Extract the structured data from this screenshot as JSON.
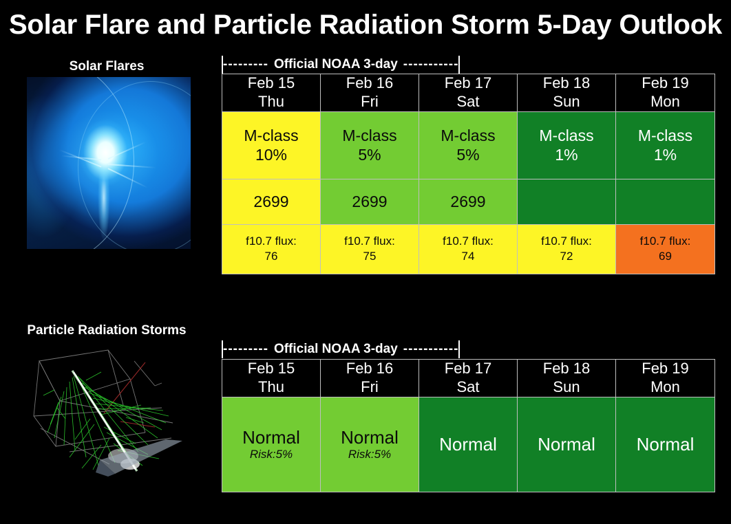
{
  "page": {
    "title": "Solar Flare and Particle Radiation Storm 5-Day Outlook",
    "background_color": "#000000"
  },
  "colors": {
    "yellow": "#FDF526",
    "light_green": "#73CC33",
    "dark_green": "#118026",
    "orange": "#F4711F",
    "black": "#000000",
    "border": "#BFBFBF",
    "text_light": "#FFFFFF",
    "text_dark": "#0A0A0A"
  },
  "sections": [
    {
      "label": "Solar Flares",
      "figure_name": "solar-flare-image",
      "noaa_bracket": {
        "left_bar": "|",
        "dashes_left": "---------",
        "text": "Official NOAA 3-day",
        "dashes_right": "-----------",
        "right_bar": "|"
      },
      "dates": [
        {
          "date": "Feb 15",
          "day": "Thu"
        },
        {
          "date": "Feb 16",
          "day": "Fri"
        },
        {
          "date": "Feb 17",
          "day": "Sat"
        },
        {
          "date": "Feb 18",
          "day": "Sun"
        },
        {
          "date": "Feb 19",
          "day": "Mon"
        }
      ],
      "flare_row": [
        {
          "line1": "M-class",
          "line2": "10%",
          "color": "yellow"
        },
        {
          "line1": "M-class",
          "line2": "5%",
          "color": "light_green"
        },
        {
          "line1": "M-class",
          "line2": "5%",
          "color": "light_green"
        },
        {
          "line1": "M-class",
          "line2": "1%",
          "color": "dark_green"
        },
        {
          "line1": "M-class",
          "line2": "1%",
          "color": "dark_green"
        }
      ],
      "region_row": [
        {
          "value": "2699",
          "color": "yellow"
        },
        {
          "value": "2699",
          "color": "light_green"
        },
        {
          "value": "2699",
          "color": "light_green"
        },
        {
          "value": "",
          "color": "dark_green"
        },
        {
          "value": "",
          "color": "dark_green"
        }
      ],
      "flux_row": [
        {
          "line1": "f10.7 flux:",
          "line2": "76",
          "color": "yellow"
        },
        {
          "line1": "f10.7 flux:",
          "line2": "75",
          "color": "yellow"
        },
        {
          "line1": "f10.7 flux:",
          "line2": "74",
          "color": "yellow"
        },
        {
          "line1": "f10.7 flux:",
          "line2": "72",
          "color": "yellow"
        },
        {
          "line1": "f10.7 flux:",
          "line2": "69",
          "color": "orange"
        }
      ]
    },
    {
      "label": "Particle Radiation Storms",
      "figure_name": "particle-shower-image",
      "noaa_bracket": {
        "left_bar": "|",
        "dashes_left": "---------",
        "text": "Official NOAA 3-day",
        "dashes_right": "-----------",
        "right_bar": "|"
      },
      "dates": [
        {
          "date": "Feb 15",
          "day": "Thu"
        },
        {
          "date": "Feb 16",
          "day": "Fri"
        },
        {
          "date": "Feb 17",
          "day": "Sat"
        },
        {
          "date": "Feb 18",
          "day": "Sun"
        },
        {
          "date": "Feb 19",
          "day": "Mon"
        }
      ],
      "storm_row": [
        {
          "line1": "Normal",
          "line2": "Risk:5%",
          "color": "light_green"
        },
        {
          "line1": "Normal",
          "line2": "Risk:5%",
          "color": "light_green"
        },
        {
          "line1": "Normal",
          "line2": "",
          "color": "dark_green"
        },
        {
          "line1": "Normal",
          "line2": "",
          "color": "dark_green"
        },
        {
          "line1": "Normal",
          "line2": "",
          "color": "dark_green"
        }
      ]
    }
  ]
}
